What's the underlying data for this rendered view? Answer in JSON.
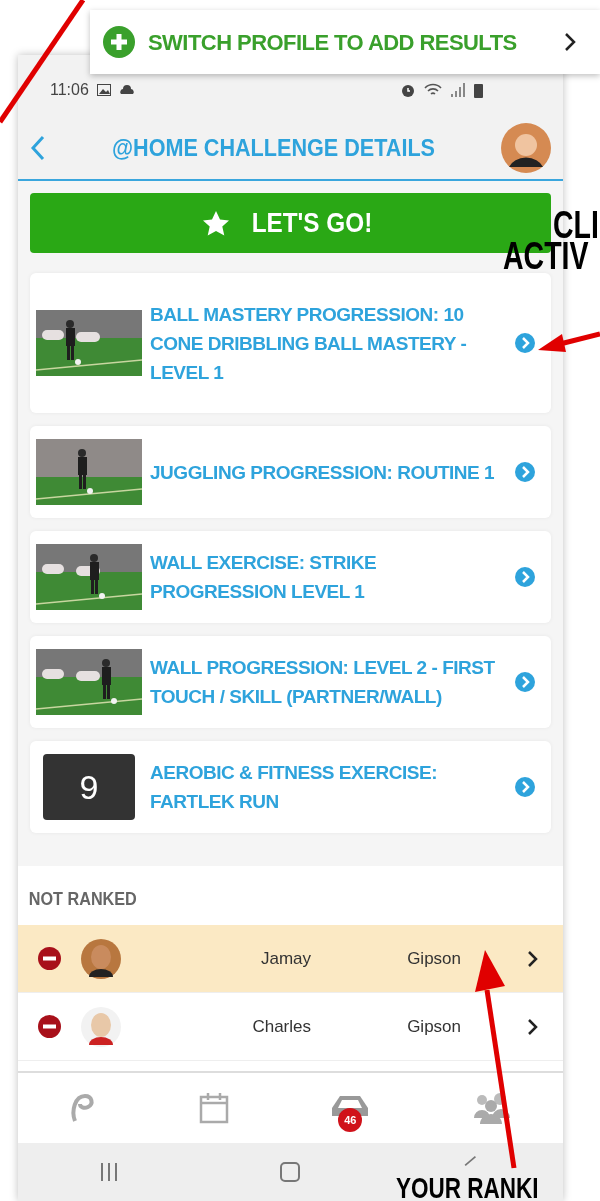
{
  "banner": {
    "text": "SWITCH PROFILE TO ADD RESULTS"
  },
  "status_bar": {
    "time": "11:06"
  },
  "header": {
    "title": "@HOME CHALLENGE DETAILS"
  },
  "start_button": {
    "label": "LET'S GO!"
  },
  "activities": [
    {
      "kind": "video",
      "title": "BALL MASTERY PROGRESSION: 10 CONE DRIBBLING BALL MASTERY - LEVEL 1"
    },
    {
      "kind": "video",
      "title": "JUGGLING PROGRESSION: ROUTINE 1"
    },
    {
      "kind": "video",
      "title": "WALL EXERCISE: STRIKE PROGRESSION LEVEL 1"
    },
    {
      "kind": "video",
      "title": "WALL PROGRESSION: LEVEL 2 - FIRST TOUCH / SKILL (PARTNER/WALL)"
    },
    {
      "kind": "number",
      "number": "9",
      "title": "AEROBIC & FITNESS EXERCISE: FARTLEK RUN"
    }
  ],
  "ranking": {
    "heading": "NOT RANKED",
    "rows": [
      {
        "first_name": "Jamay",
        "last_name": "Gipson",
        "selected": true
      },
      {
        "first_name": "Charles",
        "last_name": "Gipson",
        "selected": false
      }
    ]
  },
  "tab_bar": {
    "badge": "46"
  },
  "annotations": [
    "CLI",
    "ACTIV",
    "YOUR RANKI"
  ]
}
